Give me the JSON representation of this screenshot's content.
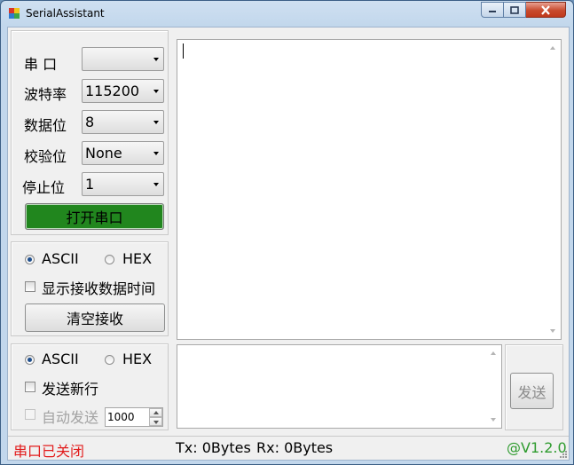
{
  "window": {
    "title": "SerialAssistant"
  },
  "settings": {
    "port_label": "串 口",
    "port_value": "",
    "baud_label": "波特率",
    "baud_value": "115200",
    "databits_label": "数据位",
    "databits_value": "8",
    "parity_label": "校验位",
    "parity_value": "None",
    "stopbits_label": "停止位",
    "stopbits_value": "1",
    "open_button": "打开串口",
    "open_button_color": "#21861e"
  },
  "receive": {
    "ascii_label": "ASCII",
    "hex_label": "HEX",
    "selected_mode": "ASCII",
    "show_time_label": "显示接收数据时间",
    "show_time_checked": false,
    "clear_button": "清空接收",
    "text": ""
  },
  "send": {
    "ascii_label": "ASCII",
    "hex_label": "HEX",
    "selected_mode": "ASCII",
    "newline_label": "发送新行",
    "newline_checked": false,
    "auto_send_label": "自动发送",
    "auto_send_checked": false,
    "interval_value": "1000",
    "send_button": "发送",
    "text": ""
  },
  "status": {
    "port_state": "串口已关闭",
    "port_state_color": "#e21d1d",
    "tx": "Tx: 0Bytes",
    "rx": "Rx: 0Bytes",
    "version": "@V1.2.0",
    "version_color": "#2e9b2e"
  }
}
